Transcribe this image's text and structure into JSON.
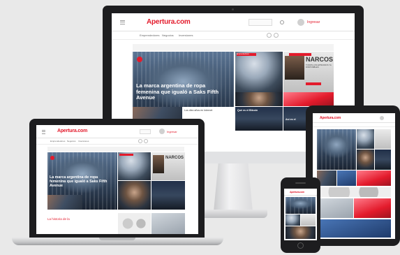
{
  "site": {
    "logo": "Apertura.com",
    "login": "Ingresar",
    "nav": [
      "Emprendedores",
      "Negocios",
      "Inversiones"
    ],
    "headline": "La marca argentina de ropa femenina que igualó a Saks Fifth Avenue",
    "narcos": "NARCOS",
    "narcos_sub": "TODOS LOS EPISODIOS YA DISPONIBLES",
    "tag": "Emprendedores",
    "story_two_line": "Los diez años en Internet",
    "story_three": "Qué es el Bitcoin",
    "story_four": "Así es el",
    "section_title": "La historia de la",
    "accent_color": "#e31b2c"
  }
}
